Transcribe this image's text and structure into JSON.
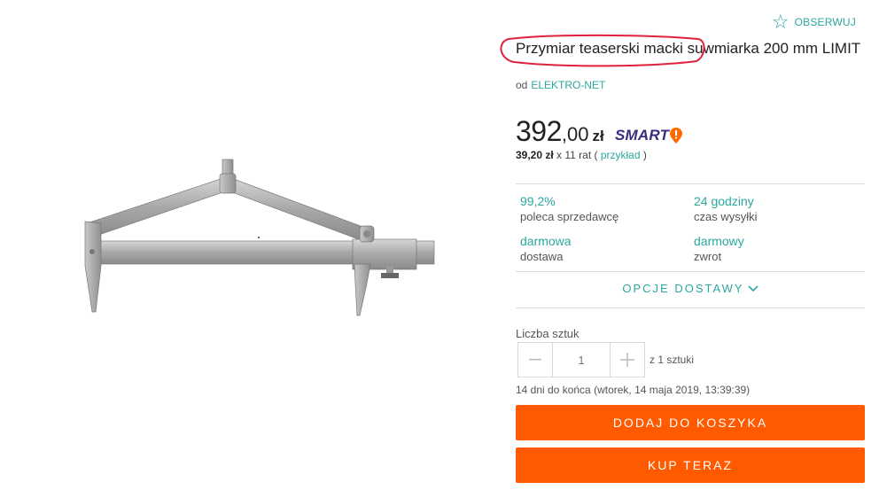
{
  "observe": {
    "label": "OBSERWUJ",
    "icon": "star-outline-icon"
  },
  "product": {
    "title": "Przymiar teaserski macki suwmiarka 200 mm LIMIT",
    "seller_prefix": "od",
    "seller_name": "ELEKTRO-NET"
  },
  "price": {
    "integer": "392",
    "decimal": ",00",
    "currency": "zł",
    "badge": "SMART",
    "installment_amount": "39,20 zł",
    "installment_rest": " x 11 rat (",
    "installment_link": "przykład",
    "installment_close": " )"
  },
  "stats": [
    {
      "value": "99,2%",
      "label": "poleca sprzedawcę"
    },
    {
      "value": "24 godziny",
      "label": "czas wysyłki"
    },
    {
      "value": "darmowa",
      "label": "dostawa"
    },
    {
      "value": "darmowy",
      "label": "zwrot"
    }
  ],
  "delivery_options": "OPCJE DOSTAWY",
  "quantity": {
    "label": "Liczba sztuk",
    "value": "1",
    "of_text": "z 1 sztuki"
  },
  "ends": "14 dni do końca (wtorek, 14 maja 2019, 13:39:39)",
  "buttons": {
    "add_to_cart": "DODAJ DO KOSZYKA",
    "buy_now": "KUP TERAZ"
  },
  "colors": {
    "accent": "#2ba8a0",
    "button": "#ff5a00",
    "smart": "#3d2c7e",
    "annotation": "#e0223a"
  }
}
